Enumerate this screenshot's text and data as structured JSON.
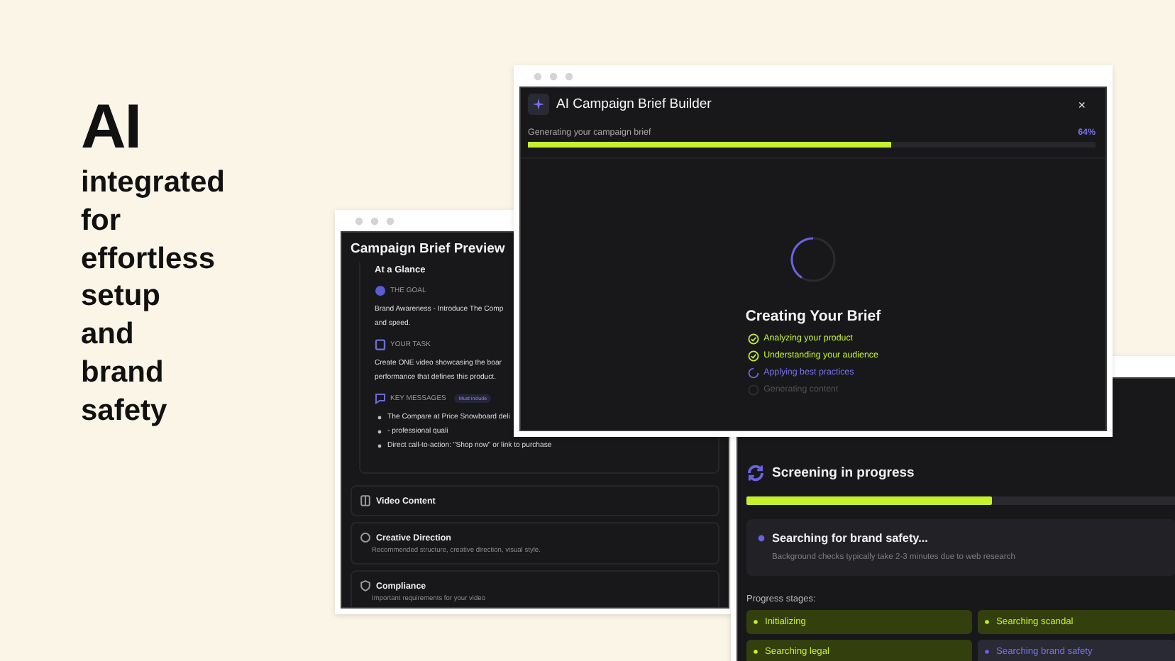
{
  "headline": {
    "title": "AI",
    "lines": [
      "integrated",
      "for",
      "effortless",
      "setup",
      "and",
      "brand",
      "safety"
    ]
  },
  "brief_preview": {
    "title": "Campaign Brief Preview",
    "glance_title": "At a Glance",
    "sections": [
      {
        "kind": "goal",
        "label": "THE GOAL",
        "lines": [
          "Brand Awareness - Introduce The Comp",
          "and speed."
        ]
      },
      {
        "kind": "task",
        "label": "YOUR TASK",
        "lines": [
          "Create ONE video showcasing the boar",
          "performance that defines this product."
        ]
      },
      {
        "kind": "messages",
        "label": "KEY MESSAGES",
        "badge": "Must include",
        "bullets": [
          "The Compare at Price Snowboard deli",
          "- professional quali",
          "Direct call-to-action: \"Shop now\" or link to purchase"
        ]
      }
    ],
    "panels": [
      {
        "kind": "video",
        "title": "Video Content"
      },
      {
        "kind": "direction",
        "title": "Creative Direction",
        "subtitle": "Recommended structure, creative direction, visual style."
      },
      {
        "kind": "compliance",
        "title": "Compliance",
        "subtitle": "Important requirements for your video"
      }
    ]
  },
  "brief_builder": {
    "title": "AI Campaign Brief Builder",
    "close": "×",
    "progress_label": "Generating your campaign brief",
    "reading": "64%",
    "level": 0.64,
    "heading": "Creating Your Brief",
    "steps": [
      {
        "label": "Analyzing your product",
        "done": true,
        "active": false
      },
      {
        "label": "Understanding your audience",
        "done": true,
        "active": false
      },
      {
        "label": "Applying best practices",
        "done": false,
        "active": true
      },
      {
        "label": "Generating content",
        "done": false,
        "active": false
      }
    ]
  },
  "screening": {
    "title": "Screening in progress",
    "level": 0.57,
    "status_title": "Searching for brand safety...",
    "status_note": "Background checks typically take 2-3 minutes due to web research",
    "stages_label": "Progress stages:",
    "stages": [
      {
        "label": "Initializing",
        "done": true,
        "active": false
      },
      {
        "label": "Searching scandal",
        "done": true,
        "active": false
      },
      {
        "label": "Searching legal",
        "done": true,
        "active": false
      },
      {
        "label": "Searching brand safety",
        "done": false,
        "active": true
      }
    ]
  }
}
